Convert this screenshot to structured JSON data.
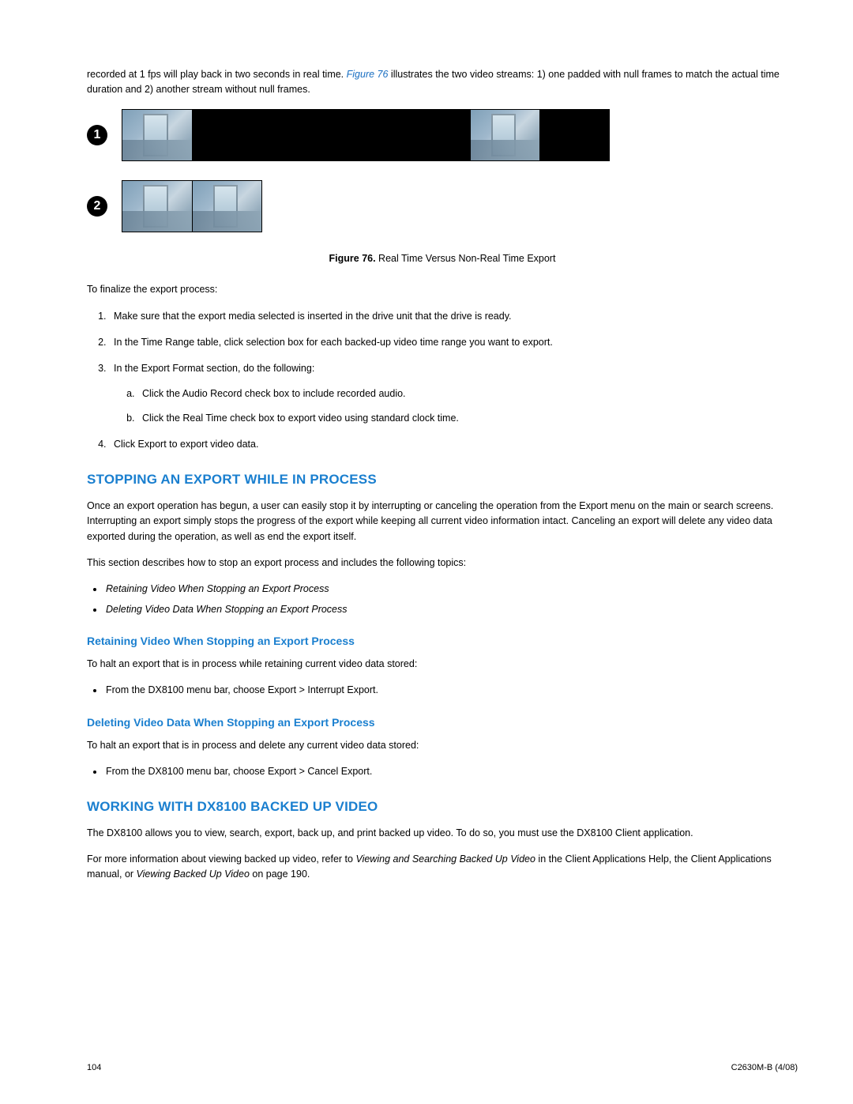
{
  "intro": {
    "pre": "recorded at 1 fps will play back in two seconds in real time. ",
    "link": "Figure 76",
    "post": " illustrates the two video streams: 1) one padded with null frames to match the actual time duration and 2) another stream without null frames."
  },
  "figure": {
    "badge1": "1",
    "badge2": "2",
    "caption_bold": "Figure 76.",
    "caption_rest": "  Real Time Versus Non-Real Time Export"
  },
  "finalize_lead": "To finalize the export process:",
  "steps": {
    "s1": "Make sure that the export media selected is inserted in the drive unit that the drive is ready.",
    "s2": "In the Time Range table, click selection box for each backed-up video time range you want to export.",
    "s3": "In the Export Format section, do the following:",
    "s3a": "Click the Audio Record check box to include recorded audio.",
    "s3b": "Click the Real Time check box to export video using standard clock time.",
    "s4": "Click Export to export video data."
  },
  "stopping": {
    "heading": "STOPPING AN EXPORT WHILE IN PROCESS",
    "p1": "Once an export operation has begun, a user can easily stop it by interrupting or canceling the operation from the Export menu on the main or search screens. Interrupting an export simply stops the progress of the export while keeping all current video information intact. Canceling an export will delete any video data exported during the operation, as well as end the export itself.",
    "p2": "This section describes how to stop an export process and includes the following topics:",
    "topics": {
      "t1": "Retaining Video When Stopping an Export Process",
      "t2": "Deleting Video Data When Stopping an Export Process"
    }
  },
  "retain": {
    "heading": "Retaining Video When Stopping an Export Process",
    "p": "To halt an export that is in process while retaining current video data stored:",
    "bullet": "From the DX8100 menu bar, choose Export > Interrupt Export."
  },
  "delete": {
    "heading": "Deleting Video Data When Stopping an Export Process",
    "p": "To halt an export that is in process and delete any current video data stored:",
    "bullet": "From the DX8100 menu bar, choose Export > Cancel Export."
  },
  "working": {
    "heading": "WORKING WITH DX8100 BACKED UP VIDEO",
    "p1": "The DX8100 allows you to view, search, export, back up, and print backed up video. To do so, you must use the DX8100 Client application.",
    "p2_pre": "For more information about viewing backed up video, refer to ",
    "p2_i1": "Viewing and Searching Backed Up Video",
    "p2_mid": " in the Client Applications Help, the Client Applications manual, or ",
    "p2_i2": "Viewing Backed Up Video",
    "p2_post": " on page 190."
  },
  "footer": {
    "page": "104",
    "doc": "C2630M-B (4/08)"
  }
}
